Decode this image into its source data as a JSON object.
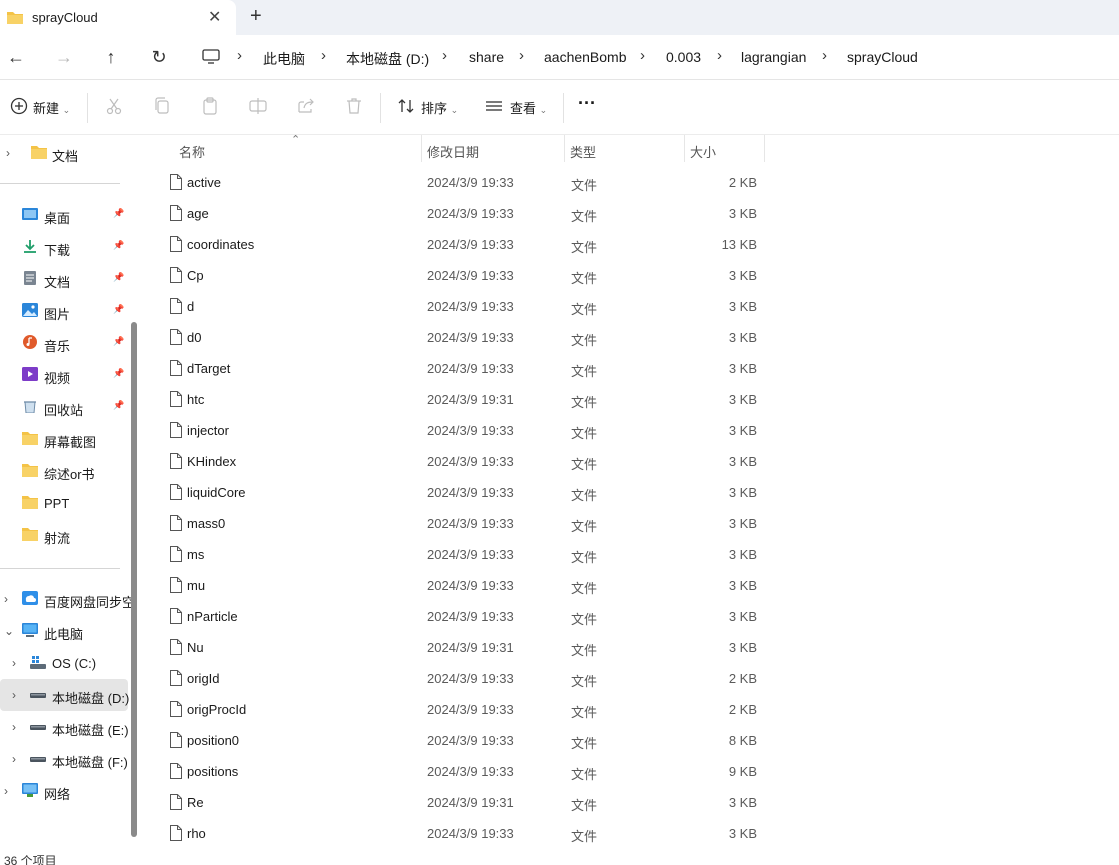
{
  "tab": {
    "title": "sprayCloud",
    "close": "✕",
    "new": "+"
  },
  "nav": {
    "back": "←",
    "forward": "→",
    "up": "↑",
    "refresh": "↻",
    "breadcrumb": [
      "此电脑",
      "本地磁盘 (D:)",
      "share",
      "aachenBomb",
      "0.003",
      "lagrangian",
      "sprayCloud"
    ]
  },
  "commands": {
    "new_label": "新建",
    "sort_label": "排序",
    "view_label": "查看",
    "more": "···"
  },
  "sidebar": {
    "top_item": "文档",
    "quick": [
      {
        "label": "桌面",
        "icon": "desktop-icon",
        "color": "#2b86d9",
        "pinned": true
      },
      {
        "label": "下载",
        "icon": "download-icon",
        "color": "#1f9e6a",
        "pinned": true
      },
      {
        "label": "文档",
        "icon": "document-icon",
        "color": "#7a8591",
        "pinned": true
      },
      {
        "label": "图片",
        "icon": "pictures-icon",
        "color": "#2b86d9",
        "pinned": true
      },
      {
        "label": "音乐",
        "icon": "music-icon",
        "color": "#e05a2b",
        "pinned": true
      },
      {
        "label": "视频",
        "icon": "video-icon",
        "color": "#7d3cc8",
        "pinned": true
      },
      {
        "label": "回收站",
        "icon": "recycle-bin-icon",
        "color": "#6f8ca8",
        "pinned": true
      },
      {
        "label": "屏幕截图",
        "icon": "folder-icon",
        "color": "#f4c347",
        "pinned": false
      },
      {
        "label": "综述or书",
        "icon": "folder-icon",
        "color": "#f4c347",
        "pinned": false
      },
      {
        "label": "PPT",
        "icon": "folder-icon",
        "color": "#f4c347",
        "pinned": false
      },
      {
        "label": "射流",
        "icon": "folder-icon",
        "color": "#f4c347",
        "pinned": false
      }
    ],
    "tree": [
      {
        "label": "百度网盘同步空",
        "icon": "baidu-sync-icon",
        "chev": "›",
        "indent": 0
      },
      {
        "label": "此电脑",
        "icon": "this-pc-icon",
        "chev": "⌄",
        "indent": 0
      },
      {
        "label": "OS (C:)",
        "icon": "windows-drive-icon",
        "chev": "›",
        "indent": 1
      },
      {
        "label": "本地磁盘 (D:)",
        "icon": "drive-icon",
        "chev": "›",
        "indent": 1,
        "selected": true
      },
      {
        "label": "本地磁盘 (E:)",
        "icon": "drive-icon",
        "chev": "›",
        "indent": 1
      },
      {
        "label": "本地磁盘 (F:)",
        "icon": "drive-icon",
        "chev": "›",
        "indent": 1
      },
      {
        "label": "网络",
        "icon": "network-icon",
        "chev": "›",
        "indent": 0
      }
    ],
    "pin_glyph": "📌"
  },
  "columns": {
    "name": "名称",
    "date": "修改日期",
    "type": "类型",
    "size": "大小",
    "sort_glyph": "⌃"
  },
  "files": [
    {
      "name": "active",
      "date": "2024/3/9 19:33",
      "type": "文件",
      "size": "2 KB"
    },
    {
      "name": "age",
      "date": "2024/3/9 19:33",
      "type": "文件",
      "size": "3 KB"
    },
    {
      "name": "coordinates",
      "date": "2024/3/9 19:33",
      "type": "文件",
      "size": "13 KB"
    },
    {
      "name": "Cp",
      "date": "2024/3/9 19:33",
      "type": "文件",
      "size": "3 KB"
    },
    {
      "name": "d",
      "date": "2024/3/9 19:33",
      "type": "文件",
      "size": "3 KB"
    },
    {
      "name": "d0",
      "date": "2024/3/9 19:33",
      "type": "文件",
      "size": "3 KB"
    },
    {
      "name": "dTarget",
      "date": "2024/3/9 19:33",
      "type": "文件",
      "size": "3 KB"
    },
    {
      "name": "htc",
      "date": "2024/3/9 19:31",
      "type": "文件",
      "size": "3 KB"
    },
    {
      "name": "injector",
      "date": "2024/3/9 19:33",
      "type": "文件",
      "size": "3 KB"
    },
    {
      "name": "KHindex",
      "date": "2024/3/9 19:33",
      "type": "文件",
      "size": "3 KB"
    },
    {
      "name": "liquidCore",
      "date": "2024/3/9 19:33",
      "type": "文件",
      "size": "3 KB"
    },
    {
      "name": "mass0",
      "date": "2024/3/9 19:33",
      "type": "文件",
      "size": "3 KB"
    },
    {
      "name": "ms",
      "date": "2024/3/9 19:33",
      "type": "文件",
      "size": "3 KB"
    },
    {
      "name": "mu",
      "date": "2024/3/9 19:33",
      "type": "文件",
      "size": "3 KB"
    },
    {
      "name": "nParticle",
      "date": "2024/3/9 19:33",
      "type": "文件",
      "size": "3 KB"
    },
    {
      "name": "Nu",
      "date": "2024/3/9 19:31",
      "type": "文件",
      "size": "3 KB"
    },
    {
      "name": "origId",
      "date": "2024/3/9 19:33",
      "type": "文件",
      "size": "2 KB"
    },
    {
      "name": "origProcId",
      "date": "2024/3/9 19:33",
      "type": "文件",
      "size": "2 KB"
    },
    {
      "name": "position0",
      "date": "2024/3/9 19:33",
      "type": "文件",
      "size": "8 KB"
    },
    {
      "name": "positions",
      "date": "2024/3/9 19:33",
      "type": "文件",
      "size": "9 KB"
    },
    {
      "name": "Re",
      "date": "2024/3/9 19:31",
      "type": "文件",
      "size": "3 KB"
    },
    {
      "name": "rho",
      "date": "2024/3/9 19:33",
      "type": "文件",
      "size": "3 KB"
    }
  ],
  "status": {
    "count_text": "36 个项目"
  }
}
